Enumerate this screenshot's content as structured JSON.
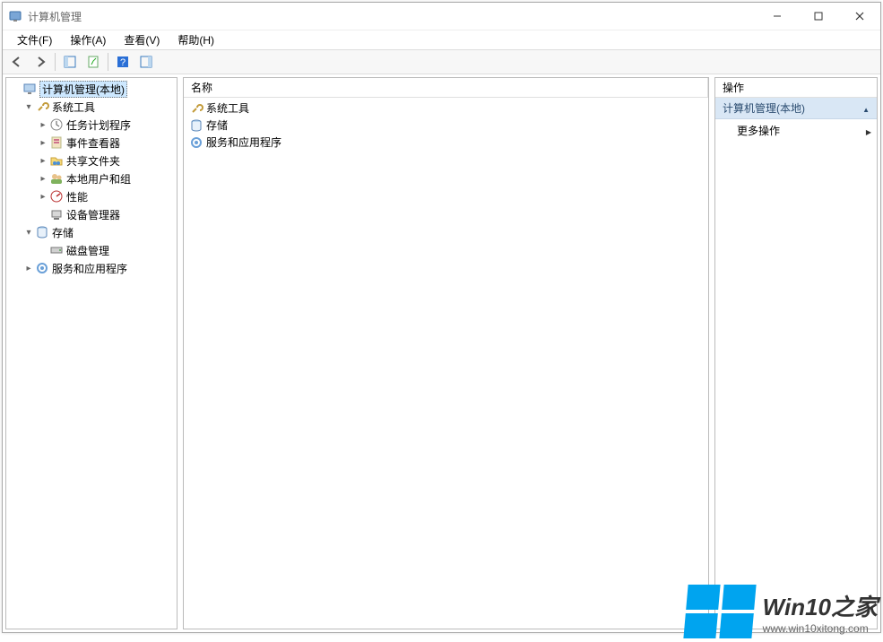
{
  "window": {
    "title": "计算机管理"
  },
  "menu": {
    "file": "文件(F)",
    "action": "操作(A)",
    "view": "查看(V)",
    "help": "帮助(H)"
  },
  "tree": {
    "root": "计算机管理(本地)",
    "system_tools": "系统工具",
    "task_scheduler": "任务计划程序",
    "event_viewer": "事件查看器",
    "shared_folders": "共享文件夹",
    "local_users": "本地用户和组",
    "performance": "性能",
    "device_manager": "设备管理器",
    "storage": "存储",
    "disk_management": "磁盘管理",
    "services_apps": "服务和应用程序"
  },
  "list": {
    "header_name": "名称",
    "item1": "系统工具",
    "item2": "存储",
    "item3": "服务和应用程序"
  },
  "actions": {
    "header": "操作",
    "group_title": "计算机管理(本地)",
    "more": "更多操作"
  },
  "watermark": {
    "line1": "Win10之家",
    "line2": "www.win10xitong.com"
  }
}
